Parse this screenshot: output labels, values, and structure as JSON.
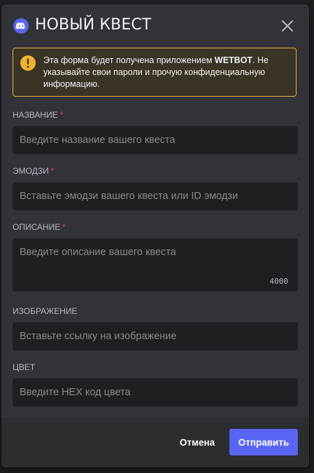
{
  "header": {
    "title": "НОВЫЙ КВЕСТ",
    "app_icon": "discord-logo-icon",
    "close_icon": "close-icon"
  },
  "notice": {
    "icon": "warning-icon",
    "text_before": "Эта форма будет получена приложением ",
    "app_name": "WETBOT",
    "text_after": ". Не указывайте свои пароли и прочую конфиденциальную информацию."
  },
  "fields": {
    "name": {
      "label": "НАЗВАНИЕ",
      "required_mark": "*",
      "value": "",
      "placeholder": "Введите название вашего квеста"
    },
    "emoji": {
      "label": "ЭМОДЗИ",
      "required_mark": "*",
      "value": "",
      "placeholder": "Вставьте эмодзи вашего квеста или ID эмодзи"
    },
    "description": {
      "label": "ОПИСАНИЕ",
      "required_mark": "*",
      "value": "",
      "placeholder": "Введите описание вашего квеста",
      "char_counter": "4000"
    },
    "image": {
      "label": "ИЗОБРАЖЕНИЕ",
      "value": "",
      "placeholder": "Вставьте ссылку на изображение"
    },
    "color": {
      "label": "ЦВЕТ",
      "value": "",
      "placeholder": "Введите HEX код цвета"
    }
  },
  "footer": {
    "cancel_label": "Отмена",
    "submit_label": "Отправить"
  },
  "colors": {
    "modal_bg": "#313338",
    "footer_bg": "#2b2d31",
    "input_bg": "#1e1f22",
    "warning_border": "#f0b232",
    "required": "#f23f43",
    "primary_button": "#5865f2"
  }
}
